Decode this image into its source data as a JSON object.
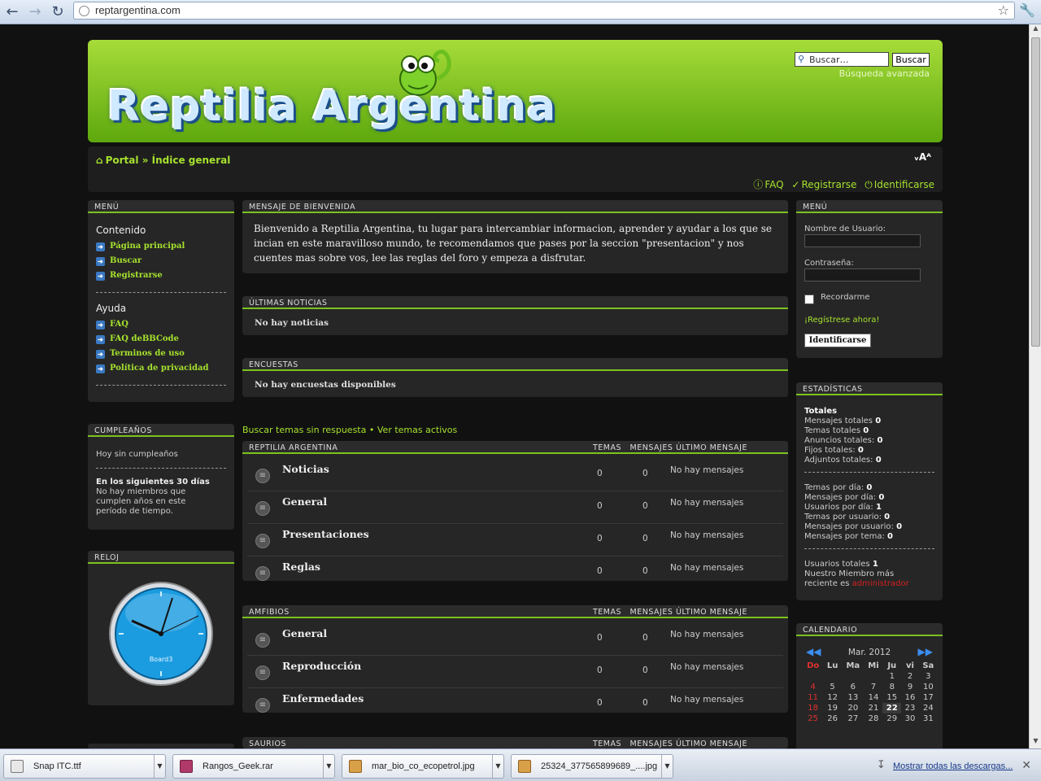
{
  "browser": {
    "url": "reptargentina.com"
  },
  "header": {
    "logo_text": "Reptilia Argentina",
    "search_placeholder": "Buscar…",
    "search_button": "Buscar",
    "advanced_search": "Búsqueda avanzada"
  },
  "navbar": {
    "breadcrumb_portal": "Portal",
    "breadcrumb_sep": "»",
    "breadcrumb_index": "Índice general",
    "font_size_control": "ᵥAᴬ",
    "faq": "FAQ",
    "register": "Registrarse",
    "login": "Identificarse"
  },
  "left_menu": {
    "title": "MENÚ",
    "section1": "Contenido",
    "items1": [
      "Página principal",
      "Buscar",
      "Registrarse"
    ],
    "section2": "Ayuda",
    "items2": [
      "FAQ",
      "FAQ deBBCode",
      "Terminos de uso",
      "Política de privacidad"
    ]
  },
  "birthdays": {
    "title": "CUMPLEAÑOS",
    "today": "Hoy sin cumpleaños",
    "next_title": "En los siguientes 30 días",
    "next_text": "No hay miembros que cumplen años en este período de tiempo."
  },
  "clock": {
    "title": "RELOJ",
    "brand": "Board3"
  },
  "welcome": {
    "title": "MENSAJE DE BIENVENIDA",
    "text": "Bienvenido a Reptilia Argentina, tu lugar para intercambiar informacion, aprender y ayudar a los que se incian en este maravilloso mundo, te recomendamos que pases por la seccion \"presentacion\" y nos cuentes mas sobre vos, lee las reglas del foro y empeza a disfrutar."
  },
  "news": {
    "title": "ÚLTIMAS NOTICIAS",
    "text": "No hay noticias"
  },
  "polls": {
    "title": "ENCUESTAS",
    "text": "No hay encuestas disponibles"
  },
  "topic_links": {
    "unanswered": "Buscar temas sin respuesta",
    "sep": "•",
    "active": "Ver temas activos"
  },
  "forum_cols": {
    "topics": "TEMAS",
    "posts": "MENSAJES",
    "last": "ÚLTIMO MENSAJE"
  },
  "categories": [
    {
      "title": "REPTILIA ARGENTINA",
      "forums": [
        {
          "name": "Noticias",
          "topics": "0",
          "posts": "0",
          "last": "No hay mensajes"
        },
        {
          "name": "General",
          "topics": "0",
          "posts": "0",
          "last": "No hay mensajes"
        },
        {
          "name": "Presentaciones",
          "topics": "0",
          "posts": "0",
          "last": "No hay mensajes"
        },
        {
          "name": "Reglas",
          "topics": "0",
          "posts": "0",
          "last": "No hay mensajes"
        }
      ]
    },
    {
      "title": "AMFIBIOS",
      "forums": [
        {
          "name": "General",
          "topics": "0",
          "posts": "0",
          "last": "No hay mensajes"
        },
        {
          "name": "Reproducción",
          "topics": "0",
          "posts": "0",
          "last": "No hay mensajes"
        },
        {
          "name": "Enfermedades",
          "topics": "0",
          "posts": "0",
          "last": "No hay mensajes"
        }
      ]
    },
    {
      "title": "SAURIOS",
      "forums": []
    }
  ],
  "right_menu": {
    "title": "MENÚ",
    "username_label": "Nombre de Usuario:",
    "password_label": "Contraseña:",
    "remember": "Recordarme",
    "register_now": "¡Regístrese ahora!",
    "login_button": "Identificarse"
  },
  "stats": {
    "title": "ESTADÍSTICAS",
    "totals_title": "Totales",
    "lines1": [
      {
        "label": "Mensajes totales",
        "value": "0"
      },
      {
        "label": "Temas totales",
        "value": "0"
      },
      {
        "label": "Anuncios totales:",
        "value": "0"
      },
      {
        "label": "Fijos totales:",
        "value": "0"
      },
      {
        "label": "Adjuntos totales:",
        "value": "0"
      }
    ],
    "lines2": [
      {
        "label": "Temas por día:",
        "value": "0"
      },
      {
        "label": "Mensajes por día:",
        "value": "0"
      },
      {
        "label": "Usuarios por día:",
        "value": "1"
      },
      {
        "label": "Temas por usuario:",
        "value": "0"
      },
      {
        "label": "Mensajes por usuario:",
        "value": "0"
      },
      {
        "label": "Mensajes por tema:",
        "value": "0"
      }
    ],
    "users_total_label": "Usuarios totales",
    "users_total_value": "1",
    "newest_label1": "Nuestro Miembro más",
    "newest_label2": "reciente es",
    "newest_member": "administrador"
  },
  "calendar": {
    "title": "CALENDARIO",
    "month": "Mar. 2012",
    "days": [
      "Do",
      "Lu",
      "Ma",
      "Mi",
      "Ju",
      "vi",
      "Sa"
    ],
    "weeks": [
      [
        "",
        "",
        "",
        "",
        "1",
        "2",
        "3"
      ],
      [
        "4",
        "5",
        "6",
        "7",
        "8",
        "9",
        "10"
      ],
      [
        "11",
        "12",
        "13",
        "14",
        "15",
        "16",
        "17"
      ],
      [
        "18",
        "19",
        "20",
        "21",
        "22",
        "23",
        "24"
      ],
      [
        "25",
        "26",
        "27",
        "28",
        "29",
        "30",
        "31"
      ]
    ],
    "today": "22"
  },
  "downloads": {
    "items": [
      "Snap ITC.ttf",
      "Rangos_Geek.rar",
      "mar_bio_co_ecopetrol.jpg",
      "25324_377565899689_....jpg"
    ],
    "show_all": "Mostrar todas las descargas..."
  }
}
